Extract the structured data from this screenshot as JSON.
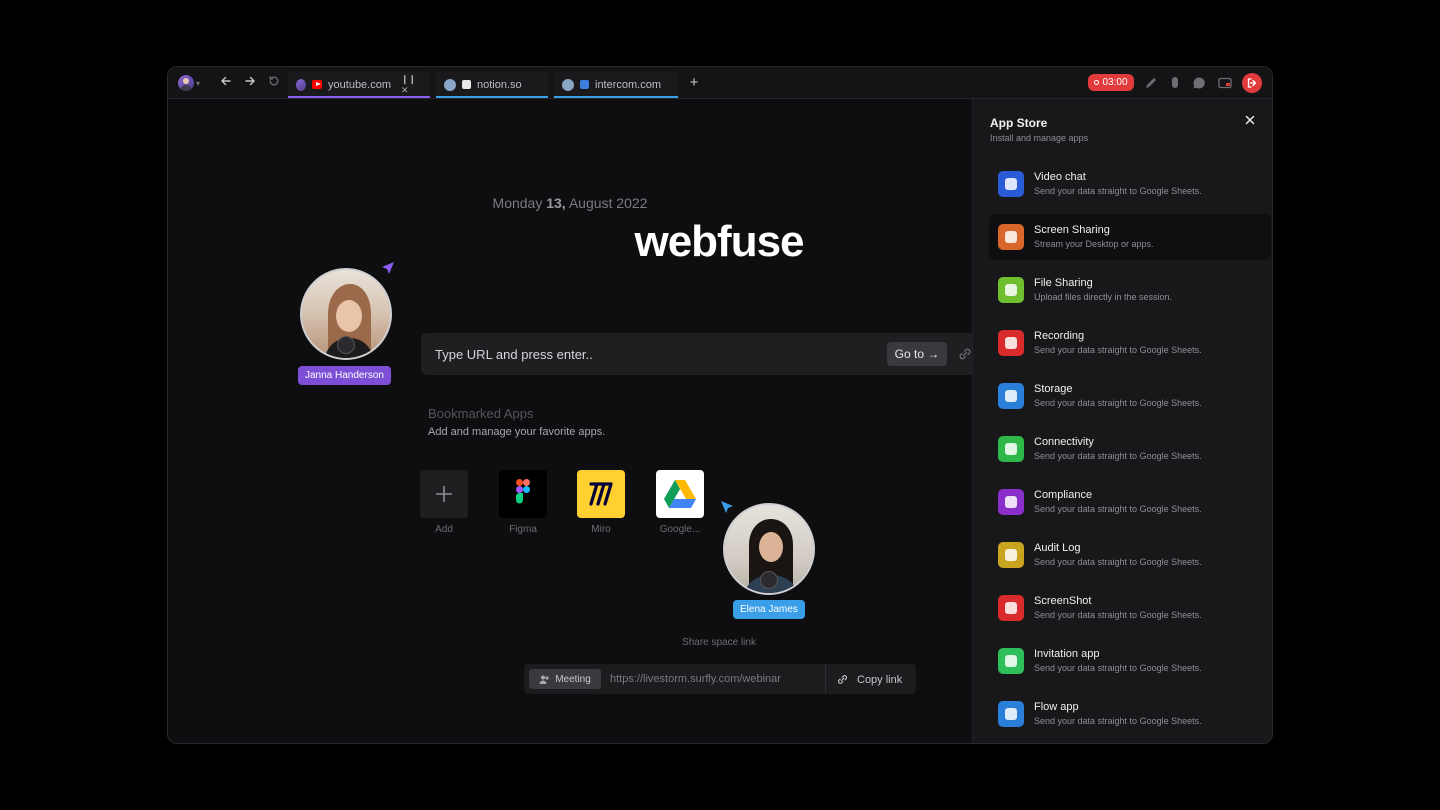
{
  "tabs": [
    {
      "label": "youtube.com",
      "underline": "#8b5cf6",
      "favicon": "youtube-icon",
      "controls": "❙❙  ✕"
    },
    {
      "label": "notion.so",
      "underline": "#3aa0e8",
      "favicon": "notion-icon"
    },
    {
      "label": "intercom.com",
      "underline": "#3aa0e8",
      "favicon": "intercom-icon"
    }
  ],
  "toolbar": {
    "recording_time": "03:00",
    "record_color": "#e23b3b"
  },
  "main": {
    "date_prefix": "Monday",
    "date_day": "13,",
    "date_suffix": "August 2022",
    "brand": "webfuse",
    "url_placeholder": "Type URL and press enter..",
    "goto_label": "Go to →",
    "bookmarks_title": "Bookmarked Apps",
    "bookmarks_sub": "Add and manage your favorite apps.",
    "apps": [
      {
        "label": "Add",
        "icon": "plus-icon"
      },
      {
        "label": "Figma",
        "icon": "figma-icon"
      },
      {
        "label": "Miro",
        "icon": "miro-icon"
      },
      {
        "label": "Google...",
        "icon": "google-drive-icon"
      }
    ],
    "share_label": "Share space link",
    "meeting_label": "Meeting",
    "share_url": "https://livestorm.surfly.com/webinar",
    "copy_label": "Copy link"
  },
  "participants": [
    {
      "name": "Janna Handerson",
      "color": "#7c4fd6"
    },
    {
      "name": "Elena James",
      "color": "#3a9ee8"
    }
  ],
  "panel": {
    "title": "App Store",
    "subtitle": "Install and manage apps",
    "items": [
      {
        "name": "Video chat",
        "desc": "Send your data straight to Google Sheets.",
        "color": "#2a5bd7",
        "icon": "video-camera-icon"
      },
      {
        "name": "Screen Sharing",
        "desc": "Stream your Desktop or apps.",
        "color": "#d9662a",
        "icon": "screen-share-icon"
      },
      {
        "name": "File Sharing",
        "desc": "Upload files directly in the session.",
        "color": "#6fbf2e",
        "icon": "file-icon"
      },
      {
        "name": "Recording",
        "desc": "Send your data straight to Google Sheets.",
        "color": "#d92b2b",
        "icon": "recording-icon"
      },
      {
        "name": "Storage",
        "desc": "Send your data straight to Google Sheets.",
        "color": "#2a7fd9",
        "icon": "storage-icon"
      },
      {
        "name": "Connectivity",
        "desc": "Send your data straight to Google Sheets.",
        "color": "#2fb84a",
        "icon": "connectivity-icon"
      },
      {
        "name": "Compliance",
        "desc": "Send your data straight to Google Sheets.",
        "color": "#8a2fc9",
        "icon": "compliance-icon"
      },
      {
        "name": "Audit Log",
        "desc": "Send your data straight to Google Sheets.",
        "color": "#c9a41f",
        "icon": "fingerprint-icon"
      },
      {
        "name": "ScreenShot",
        "desc": "Send your data straight to Google Sheets.",
        "color": "#d92b2b",
        "icon": "camera-icon"
      },
      {
        "name": "Invitation app",
        "desc": "Send your data straight to Google Sheets.",
        "color": "#2fbf5a",
        "icon": "add-user-icon"
      },
      {
        "name": "Flow app",
        "desc": "Send your data straight to Google Sheets.",
        "color": "#2a7fd9",
        "icon": "flow-icon"
      }
    ]
  }
}
